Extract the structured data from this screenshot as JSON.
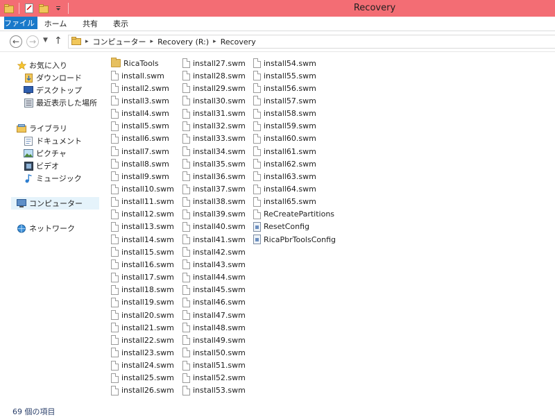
{
  "window": {
    "title": "Recovery"
  },
  "ribbon": {
    "tabs": [
      "ファイル",
      "ホーム",
      "共有",
      "表示"
    ]
  },
  "address": {
    "crumbs": [
      "コンピューター",
      "Recovery (R:)",
      "Recovery"
    ]
  },
  "sidebar": {
    "favorites": "お気に入り",
    "downloads": "ダウンロード",
    "desktop": "デスクトップ",
    "recent": "最近表示した場所",
    "libraries": "ライブラリ",
    "documents": "ドキュメント",
    "pictures": "ピクチャ",
    "videos": "ビデオ",
    "music": "ミュージック",
    "computer": "コンピューター",
    "network": "ネットワーク"
  },
  "files": {
    "col1": [
      "RicaTools",
      "install.swm",
      "install2.swm",
      "install3.swm",
      "install4.swm",
      "install5.swm",
      "install6.swm",
      "install7.swm",
      "install8.swm",
      "install9.swm",
      "install10.swm",
      "install11.swm",
      "install12.swm",
      "install13.swm",
      "install14.swm",
      "install15.swm",
      "install16.swm",
      "install17.swm",
      "install18.swm",
      "install19.swm",
      "install20.swm",
      "install21.swm",
      "install22.swm",
      "install23.swm",
      "install24.swm",
      "install25.swm",
      "install26.swm"
    ],
    "col2": [
      "install27.swm",
      "install28.swm",
      "install29.swm",
      "install30.swm",
      "install31.swm",
      "install32.swm",
      "install33.swm",
      "install34.swm",
      "install35.swm",
      "install36.swm",
      "install37.swm",
      "install38.swm",
      "install39.swm",
      "install40.swm",
      "install41.swm",
      "install42.swm",
      "install43.swm",
      "install44.swm",
      "install45.swm",
      "install46.swm",
      "install47.swm",
      "install48.swm",
      "install49.swm",
      "install50.swm",
      "install51.swm",
      "install52.swm",
      "install53.swm"
    ],
    "col3": [
      "install54.swm",
      "install55.swm",
      "install56.swm",
      "install57.swm",
      "install58.swm",
      "install59.swm",
      "install60.swm",
      "install61.swm",
      "install62.swm",
      "install63.swm",
      "install64.swm",
      "install65.swm",
      "ReCreatePartitions",
      "ResetConfig",
      "RicaPbrToolsConfig"
    ]
  },
  "status": {
    "count": "69 個の項目"
  }
}
